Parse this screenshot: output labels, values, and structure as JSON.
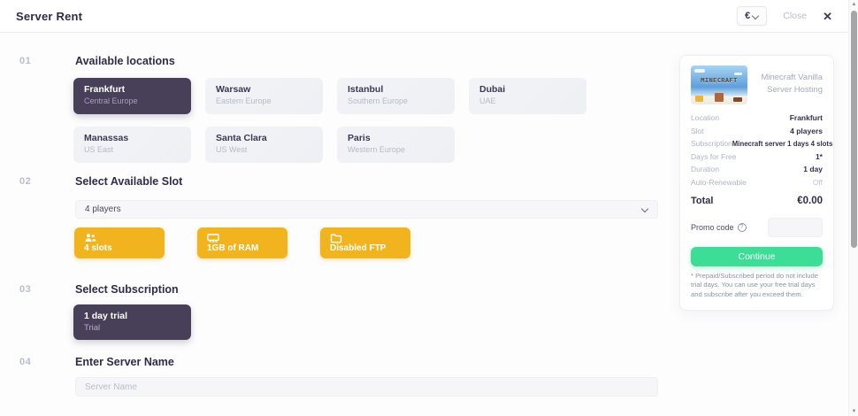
{
  "topbar": {
    "title": "Server Rent",
    "currency": "€",
    "close_label": "Close",
    "close_icon": "✕"
  },
  "sections": {
    "locations": {
      "number": "01",
      "title": "Available locations",
      "items": [
        {
          "name": "Frankfurt",
          "region": "Central Europe",
          "selected": true
        },
        {
          "name": "Warsaw",
          "region": "Eastern Europe",
          "selected": false
        },
        {
          "name": "Istanbul",
          "region": "Southern Europe",
          "selected": false
        },
        {
          "name": "Dubai",
          "region": "UAE",
          "selected": false
        },
        {
          "name": "Manassas",
          "region": "US East",
          "selected": false
        },
        {
          "name": "Santa Clara",
          "region": "US West",
          "selected": false
        },
        {
          "name": "Paris",
          "region": "Western Europe",
          "selected": false
        }
      ]
    },
    "slot": {
      "number": "02",
      "title": "Select Available Slot",
      "dropdown_value": "4 players",
      "badges": [
        {
          "icon": "users-icon",
          "label": "4 slots"
        },
        {
          "icon": "ram-icon",
          "label": "1GB of RAM"
        },
        {
          "icon": "folder-icon",
          "label": "Disabled FTP"
        }
      ]
    },
    "subscription": {
      "number": "03",
      "title": "Select Subscription",
      "options": [
        {
          "name": "1 day trial",
          "type": "Trial",
          "selected": true
        }
      ]
    },
    "server_name": {
      "number": "04",
      "title": "Enter Server Name",
      "placeholder": "Server Name"
    }
  },
  "summary": {
    "image_label": "MINECRAFT",
    "product_title": "Minecraft Vanilla Server Hosting",
    "details": [
      {
        "label": "Location",
        "value": "Frankfurt"
      },
      {
        "label": "Slot",
        "value": "4 players"
      },
      {
        "label": "Subscription",
        "value": "Minecraft server 1 days 4 slots"
      },
      {
        "label": "Days for Free",
        "value": "1*"
      },
      {
        "label": "Duration",
        "value": "1 day"
      },
      {
        "label": "Auto-Renewable",
        "value": "Off"
      }
    ],
    "total_label": "Total",
    "total_value": "€0.00",
    "promo_label": "Promo code",
    "continue_label": "Continue",
    "disclaimer": "* Prepaid/Subscribed period do not include trial days. You can use your free trial days and subscribe after you exceed them."
  },
  "colors": {
    "accent_dark": "#474058",
    "accent_yellow": "#f2b41e",
    "accent_green": "#3ddc97",
    "heading_text": "#2e2c49",
    "muted_text": "#b4bac8"
  }
}
